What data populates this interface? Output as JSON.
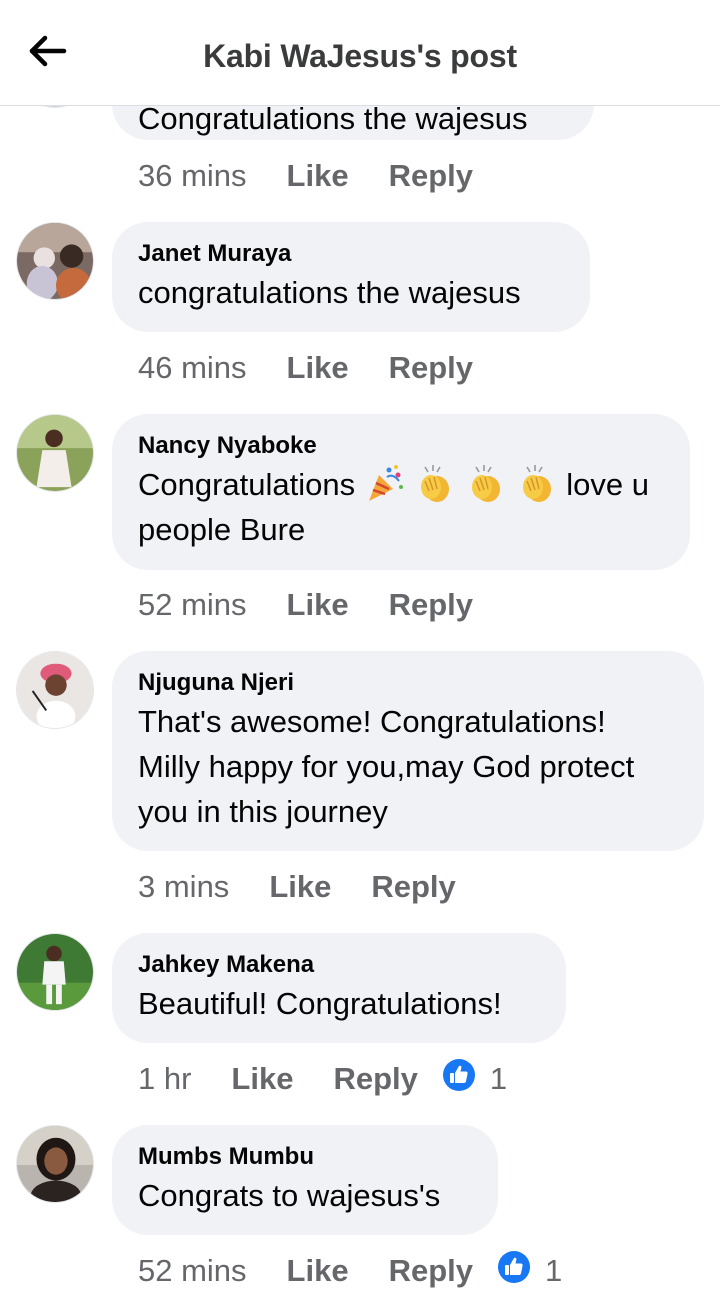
{
  "header": {
    "title": "Kabi WaJesus's post",
    "back_icon": "arrow-left-icon"
  },
  "comments": [
    {
      "text": "Congratulations the wajesus",
      "time": "36 mins",
      "like": "Like",
      "reply": "Reply"
    },
    {
      "author": "Janet Muraya",
      "text": "congratulations the wajesus",
      "time": "46 mins",
      "like": "Like",
      "reply": "Reply"
    },
    {
      "author": "Nancy Nyaboke",
      "text_before_emoji": "Congratulations",
      "emojis": [
        "party-popper-emoji",
        "clapping-hands-emoji",
        "clapping-hands-emoji",
        "clapping-hands-emoji"
      ],
      "text_after_emoji": "love u",
      "text_line2": "people Bure",
      "time": "52 mins",
      "like": "Like",
      "reply": "Reply"
    },
    {
      "author": "Njuguna Njeri",
      "text_lines": [
        "That's awesome! Congratulations!",
        "Milly happy for you,may God protect",
        "you in this journey"
      ],
      "time": "3 mins",
      "like": "Like",
      "reply": "Reply"
    },
    {
      "author": "Jahkey Makena",
      "text": "Beautiful! Congratulations!",
      "time": "1 hr",
      "like": "Like",
      "reply": "Reply",
      "reaction_icon": "thumbs-up-icon",
      "reaction_count": "1"
    },
    {
      "author": "Mumbs Mumbu",
      "text": "Congrats to wajesus's",
      "time": "52 mins",
      "like": "Like",
      "reply": "Reply",
      "reaction_icon": "thumbs-up-icon",
      "reaction_count": "1"
    }
  ],
  "colors": {
    "bubble": "#f0f2f5",
    "secondary_text": "#65676b",
    "like_blue": "#1877f2"
  }
}
